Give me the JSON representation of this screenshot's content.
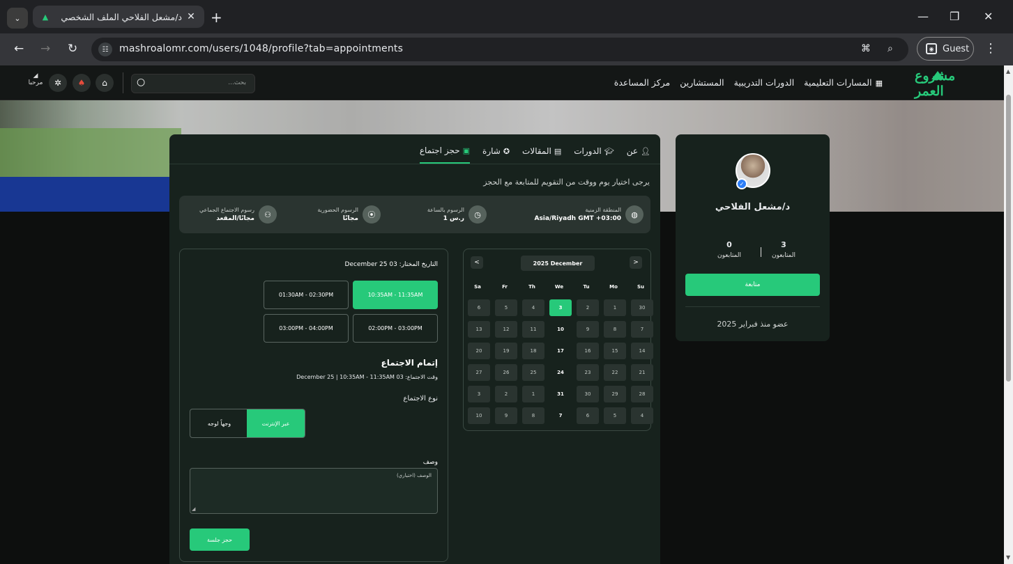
{
  "browser": {
    "tab_title": "د/مشعل الفلاحي الملف الشخصي",
    "url": "mashroalomr.com/users/1048/profile?tab=appointments",
    "guest_label": "Guest"
  },
  "site_header": {
    "logo_text": "مشروع العمر",
    "nav": [
      "المسارات التعليمية",
      "الدورات التدريبية",
      "المستشارين",
      "مركز المساعدة"
    ],
    "search_placeholder": "بحث...",
    "user_label": "مرحبا"
  },
  "profile": {
    "name": "د/مشعل الفلاحي",
    "following_count": "3",
    "following_label": "المتابعون",
    "followers_count": "0",
    "followers_label": "المتابعون",
    "follow_button": "متابعة",
    "member_since": "عضو منذ فبراير 2025"
  },
  "tabs": [
    {
      "label": "عن",
      "icon": "user-icon"
    },
    {
      "label": "الدورات",
      "icon": "graduation-cap-icon"
    },
    {
      "label": "المقالات",
      "icon": "newspaper-icon"
    },
    {
      "label": "شارة",
      "icon": "badge-icon"
    },
    {
      "label": "حجز اجتماع",
      "icon": "calendar-check-icon",
      "active": true
    }
  ],
  "instructions": "يرجى اختيار يوم ووقت من التقويم للمتابعة مع الحجز",
  "info_bar": {
    "timezone_label": "المنطقة الزمنية",
    "timezone_value": "Asia/Riyadh GMT +03:00",
    "hourly_label": "الرسوم بالساعة",
    "hourly_value": "1 ر.س",
    "inperson_label": "الرسوم الحضورية",
    "inperson_value": "مجانًا",
    "group_label": "رسوم الاجتماع الجماعي",
    "group_value": "مجانًا/المقعد"
  },
  "calendar": {
    "month_label": "2025 December",
    "weekdays": [
      "Su",
      "Mo",
      "Tu",
      "We",
      "Th",
      "Fr",
      "Sa"
    ],
    "weeks": [
      [
        "30",
        "1",
        "2",
        "3",
        "4",
        "5",
        "6"
      ],
      [
        "7",
        "8",
        "9",
        "10",
        "11",
        "12",
        "13"
      ],
      [
        "14",
        "15",
        "16",
        "17",
        "18",
        "19",
        "20"
      ],
      [
        "21",
        "22",
        "23",
        "24",
        "25",
        "26",
        "27"
      ],
      [
        "28",
        "29",
        "30",
        "31",
        "1",
        "2",
        "3"
      ],
      [
        "4",
        "5",
        "6",
        "7",
        "8",
        "9",
        "10"
      ]
    ],
    "selected_day": "3",
    "prev_label": "<",
    "next_label": ">"
  },
  "booking": {
    "selected_date_label": "التاريخ المختار: December 25 03",
    "slots": [
      "10:35AM - 11:35AM",
      "01:30AM - 02:30PM",
      "02:00PM - 03:00PM",
      "03:00PM - 04:00PM"
    ],
    "complete_title": "إتمام الاجتماع",
    "meeting_time": "وقت الاجتماع: December 25 | 10:35AM - 11:35AM 03",
    "meeting_type_label": "نوع الاجتماع",
    "type_online": "عبر الإنترنت",
    "type_inperson": "وجهاً لوجه",
    "description_label": "وصف",
    "description_placeholder": "الوصف (اختياري)",
    "submit": "حجز جلسة"
  },
  "colors": {
    "accent": "#27c97a",
    "card_bg": "#17221d",
    "page_bg": "#0d0f0e"
  }
}
